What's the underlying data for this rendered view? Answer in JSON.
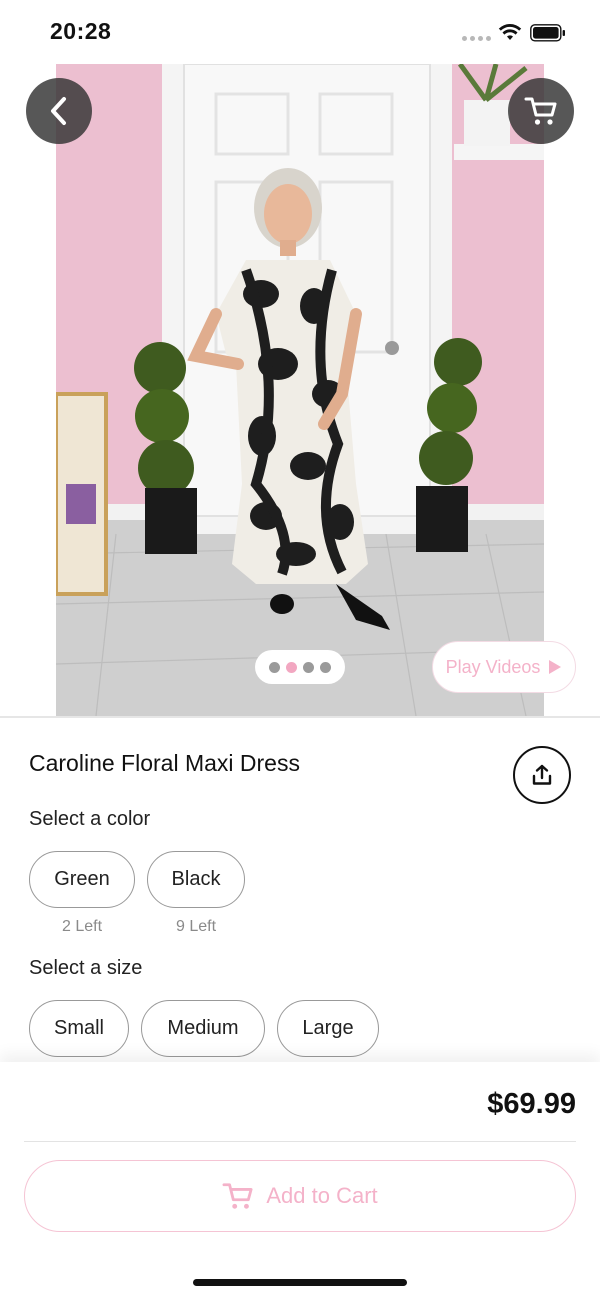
{
  "status_bar": {
    "time": "20:28"
  },
  "product": {
    "title": "Caroline Floral Maxi Dress",
    "price": "$69.99"
  },
  "gallery": {
    "image_count": 4,
    "active_index": 1,
    "play_videos_label": "Play Videos"
  },
  "color_section": {
    "label": "Select a color",
    "options": [
      {
        "label": "Green",
        "stock": "2 Left"
      },
      {
        "label": "Black",
        "stock": "9 Left"
      }
    ]
  },
  "size_section": {
    "label": "Select a size",
    "options": [
      {
        "label": "Small"
      },
      {
        "label": "Medium"
      },
      {
        "label": "Large"
      }
    ]
  },
  "actions": {
    "add_to_cart_label": "Add to Cart"
  },
  "icons": {
    "back": "chevron-left-icon",
    "cart": "shopping-cart-icon",
    "share": "share-icon",
    "play": "play-icon"
  },
  "colors": {
    "accent_pink": "#f4b2c9",
    "text": "#111111",
    "overlay_button": "#3a3a3a"
  }
}
